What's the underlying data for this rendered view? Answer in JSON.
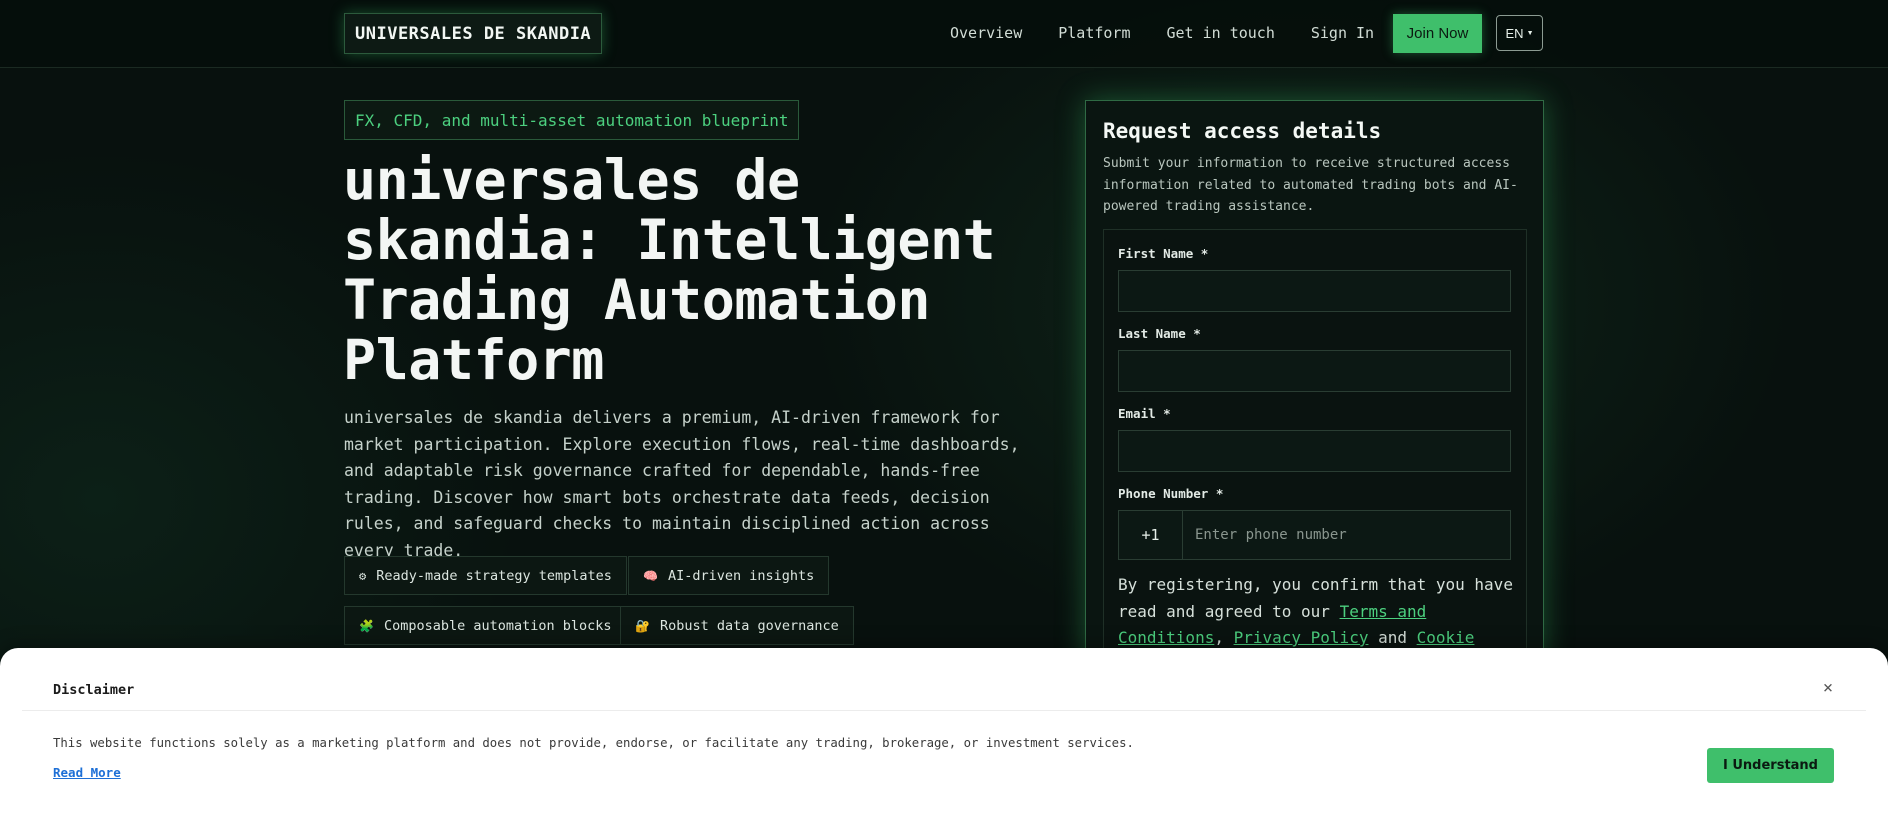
{
  "header": {
    "logo": "UNIVERSALES DE SKANDIA",
    "nav": [
      "Overview",
      "Platform",
      "Get in touch",
      "Sign In"
    ],
    "join_label": "Join Now",
    "lang_label": "EN"
  },
  "hero": {
    "tagline": "FX, CFD, and multi-asset automation blueprint",
    "title": "universales de skandia: Intelligent Trading Automation Platform",
    "description": "universales de skandia delivers a premium, AI-driven framework for market participation. Explore execution flows, real-time dashboards, and adaptable risk governance crafted for dependable, hands-free trading. Discover how smart bots orchestrate data feeds, decision rules, and safeguard checks to maintain disciplined action across every trade.",
    "features": [
      {
        "icon": "gear-icon",
        "glyph": "⚙",
        "label": "Ready-made strategy templates"
      },
      {
        "icon": "brain-icon",
        "glyph": "🧠",
        "label": "AI-driven insights"
      },
      {
        "icon": "puzzle-icon",
        "glyph": "🧩",
        "label": "Composable automation blocks"
      },
      {
        "icon": "lock-icon",
        "glyph": "🔐",
        "label": "Robust data governance"
      }
    ]
  },
  "form": {
    "title": "Request access details",
    "subtitle": "Submit your information to receive structured access information related to automated trading bots and AI-powered trading assistance.",
    "first_name_label": "First Name *",
    "last_name_label": "Last Name *",
    "email_label": "Email *",
    "phone_label": "Phone Number *",
    "phone_code": "+1",
    "phone_placeholder": "Enter phone number",
    "consent_prefix": "By registering, you confirm that you have read and agreed to our ",
    "terms_link": "Terms and Conditions",
    "sep1": ", ",
    "privacy_link": "Privacy Policy",
    "sep2": " and ",
    "cookie_link": "Cookie"
  },
  "disclaimer": {
    "title": "Disclaimer",
    "close": "×",
    "text": "This website functions solely as a marketing platform and does not provide, endorse, or facilitate any trading, brokerage, or investment services.",
    "read_more": "Read More",
    "button": "I Understand"
  },
  "colors": {
    "accent": "#3fbf6b",
    "background": "#08110e",
    "link": "#1d6fd6"
  }
}
